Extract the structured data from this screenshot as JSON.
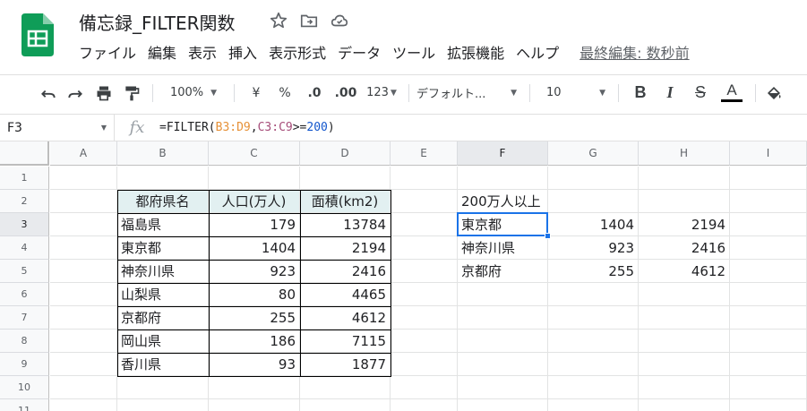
{
  "app": {
    "title": "備忘録_FILTER関数",
    "menu": [
      "ファイル",
      "編集",
      "表示",
      "挿入",
      "表示形式",
      "データ",
      "ツール",
      "拡張機能",
      "ヘルプ"
    ],
    "last_edit": "最終編集: 数秒前",
    "brand_color": "#0f9d58"
  },
  "toolbar": {
    "zoom": "100%",
    "currency": "¥",
    "percent": "%",
    "decimal_decrease": ".0",
    "decimal_increase": ".00",
    "more_formats": "123",
    "font": "デフォルト...",
    "font_size": "10",
    "bold": "B",
    "italic": "I",
    "strike": "S",
    "text_color_label": "A"
  },
  "formula_bar": {
    "cell_ref": "F3",
    "fx": "fx",
    "formula_parts": [
      "=FILTER(",
      "B3:D9",
      ",",
      "C3:C9",
      ">=",
      "200",
      ")"
    ]
  },
  "sheet": {
    "columns": [
      "A",
      "B",
      "C",
      "D",
      "E",
      "F",
      "G",
      "H",
      "I"
    ],
    "rows": [
      "1",
      "2",
      "3",
      "4",
      "5",
      "6",
      "7",
      "8",
      "9",
      "10",
      "11"
    ],
    "selected_cell": "F3",
    "table_headers": [
      "都府県名",
      "人口(万人)",
      "面積(km2)"
    ],
    "table_rows": [
      [
        "福島県",
        "179",
        "13784"
      ],
      [
        "東京都",
        "1404",
        "2194"
      ],
      [
        "神奈川県",
        "923",
        "2416"
      ],
      [
        "山梨県",
        "80",
        "4465"
      ],
      [
        "京都府",
        "255",
        "4612"
      ],
      [
        "岡山県",
        "186",
        "7115"
      ],
      [
        "香川県",
        "93",
        "1877"
      ]
    ],
    "filter_title": "200万人以上",
    "filter_rows": [
      [
        "東京都",
        "1404",
        "2194"
      ],
      [
        "神奈川県",
        "923",
        "2416"
      ],
      [
        "京都府",
        "255",
        "4612"
      ]
    ],
    "header_fill": "#e2f0f1",
    "selection_color": "#1a73e8"
  }
}
